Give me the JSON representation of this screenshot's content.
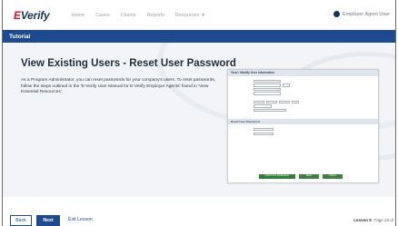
{
  "logo": {
    "prefix": "E",
    "text": "Verify"
  },
  "nav": {
    "items": [
      "Home",
      "Cases",
      "Clients",
      "Reports"
    ],
    "resources": "Resources",
    "user": "Employer Agent User"
  },
  "tutorial_bar": {
    "label": "Tutorial"
  },
  "main": {
    "title": "View Existing Users - Reset User Password",
    "body": "As a Program Administrator, you can reset passwords for your company's users. To reset passwords, follow the steps outlined in the 'E-Verify User Manual for E-Verify Employer Agents' found in 'View Essential Resources'."
  },
  "mock_form": {
    "header": "View / Modify User Information",
    "section_reset": "Reset User Password",
    "buttons": [
      "Submit User Modifications",
      "Reset",
      "Cancel"
    ]
  },
  "footer": {
    "back": "Back",
    "next": "Next",
    "exit": "Exit Lesson",
    "lesson": "Lesson 5",
    "page": "Page 23 of"
  },
  "colors": {
    "brand_blue": "#1e4b8f",
    "logo_red": "#c8102e",
    "hero_bg": "#f2f4f7"
  }
}
